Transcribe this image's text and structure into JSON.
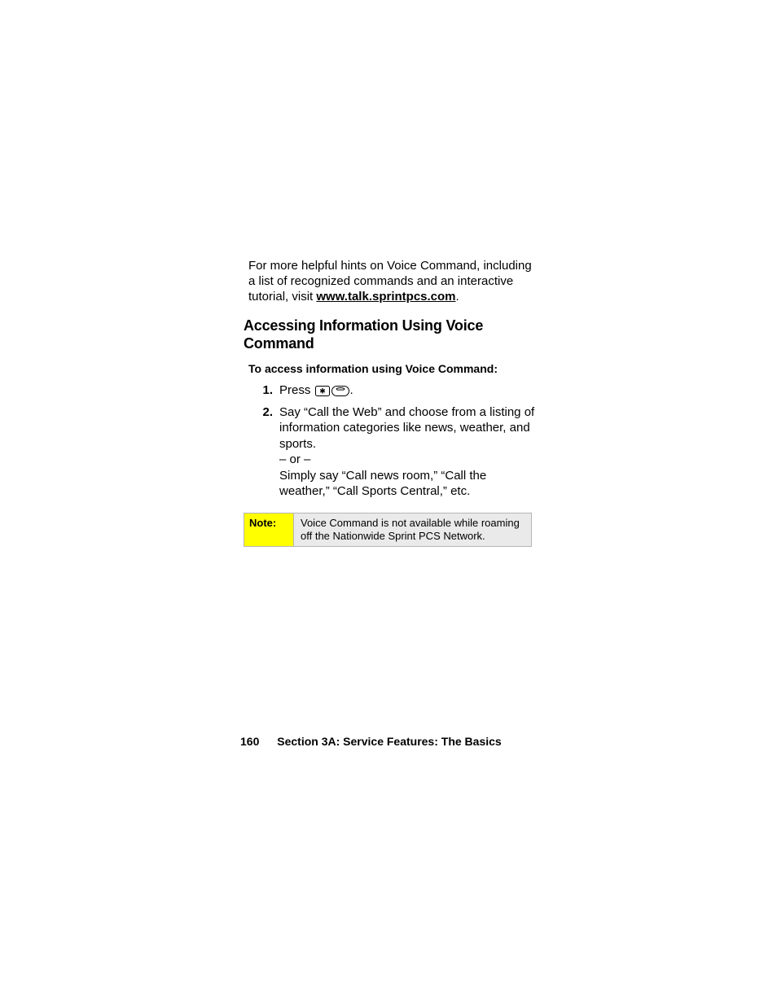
{
  "intro": {
    "line": "For more helpful hints on Voice Command, including a list of recognized commands and an interactive tutorial, visit ",
    "link": "www.talk.sprintpcs.com",
    "after": "."
  },
  "heading": "Accessing Information Using Voice Command",
  "subhead": "To access information using Voice Command:",
  "steps": [
    {
      "num": "1.",
      "prefix": "Press ",
      "suffix": "."
    },
    {
      "num": "2.",
      "text": "Say “Call the Web” and choose from a listing of information categories like news, weather, and sports.",
      "or": "– or –",
      "text2": "Simply say “Call news room,” “Call the weather,” “Call Sports Central,” etc."
    }
  ],
  "note": {
    "label": "Note:",
    "text": "Voice Command is not available while roaming off the Nationwide Sprint PCS Network."
  },
  "footer": {
    "page": "160",
    "section": "Section 3A: Service Features: The Basics"
  }
}
